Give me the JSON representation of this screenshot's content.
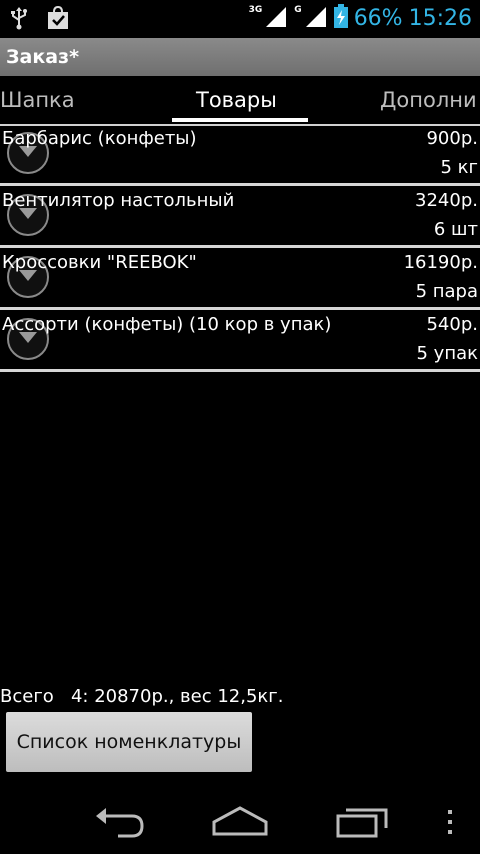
{
  "status_bar": {
    "icons": [
      "usb-icon",
      "shopping-bag-icon",
      "signal-3g-icon",
      "signal-g-icon",
      "battery-charging-icon"
    ],
    "net_labels": [
      "3G",
      "G"
    ],
    "battery": "66%",
    "time": "15:26",
    "accent_color": "#33b5e5"
  },
  "title": "Заказ*",
  "tabs": [
    {
      "label": "Шапка",
      "active": false
    },
    {
      "label": "Товары",
      "active": true
    },
    {
      "label": "Дополни",
      "active": false
    }
  ],
  "items": [
    {
      "name": "Барбарис (конфеты)",
      "price": "900р.",
      "qty": "5 кг"
    },
    {
      "name": "Вентилятор настольный",
      "price": "3240р.",
      "qty": "6 шт"
    },
    {
      "name": "Кроссовки \"REEBOK\"",
      "price": "16190р.",
      "qty": "5 пара"
    },
    {
      "name": "Ассорти (конфеты) (10 кор в упак)",
      "price": "540р.",
      "qty": "5 упак"
    }
  ],
  "footer": {
    "total": "Всего   4: 20870р., вес 12,5кг.",
    "button_label": "Список номенклатуры"
  },
  "nav_icons": [
    "back-icon",
    "home-icon",
    "recent-apps-icon",
    "menu-icon"
  ]
}
